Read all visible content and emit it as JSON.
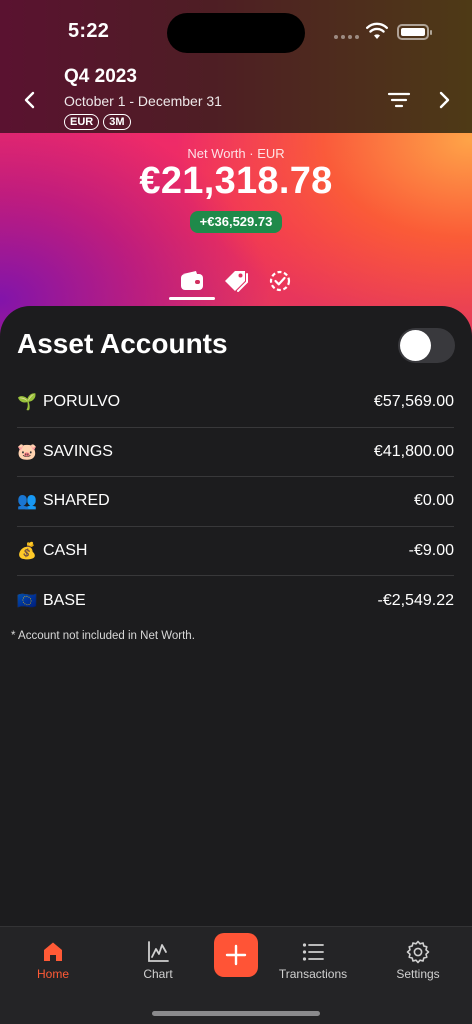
{
  "status_bar": {
    "time": "5:22"
  },
  "header": {
    "title": "Q4 2023",
    "range": "October 1 - December 31",
    "chips": [
      "EUR",
      "3M"
    ]
  },
  "net_worth": {
    "label": "Net Worth · EUR",
    "value": "€21,318.78",
    "change": "+€36,529.73"
  },
  "view_tabs": [
    {
      "icon": "wallet-icon",
      "active": true
    },
    {
      "icon": "tags-icon",
      "active": false
    },
    {
      "icon": "dashed-check-circle-icon",
      "active": false
    }
  ],
  "section": {
    "title": "Asset Accounts",
    "toggle_on": false
  },
  "accounts": [
    {
      "emoji": "🌱",
      "name": "PORULVO",
      "value": "€57,569.00"
    },
    {
      "emoji": "🐷",
      "name": "SAVINGS",
      "value": "€41,800.00"
    },
    {
      "emoji": "👥",
      "name": "SHARED",
      "value": "€0.00"
    },
    {
      "emoji": "💰",
      "name": "CASH",
      "value": "-€9.00"
    },
    {
      "emoji": "🇪🇺",
      "name": "BASE",
      "value": "-€2,549.22"
    }
  ],
  "footnote": "* Account not included in Net Worth.",
  "tabbar": {
    "home": "Home",
    "chart": "Chart",
    "transactions": "Transactions",
    "settings": "Settings"
  },
  "colors": {
    "accent": "#ff5436",
    "positive_badge": "#1f8a4a",
    "panel_bg": "#1c1c1e"
  }
}
